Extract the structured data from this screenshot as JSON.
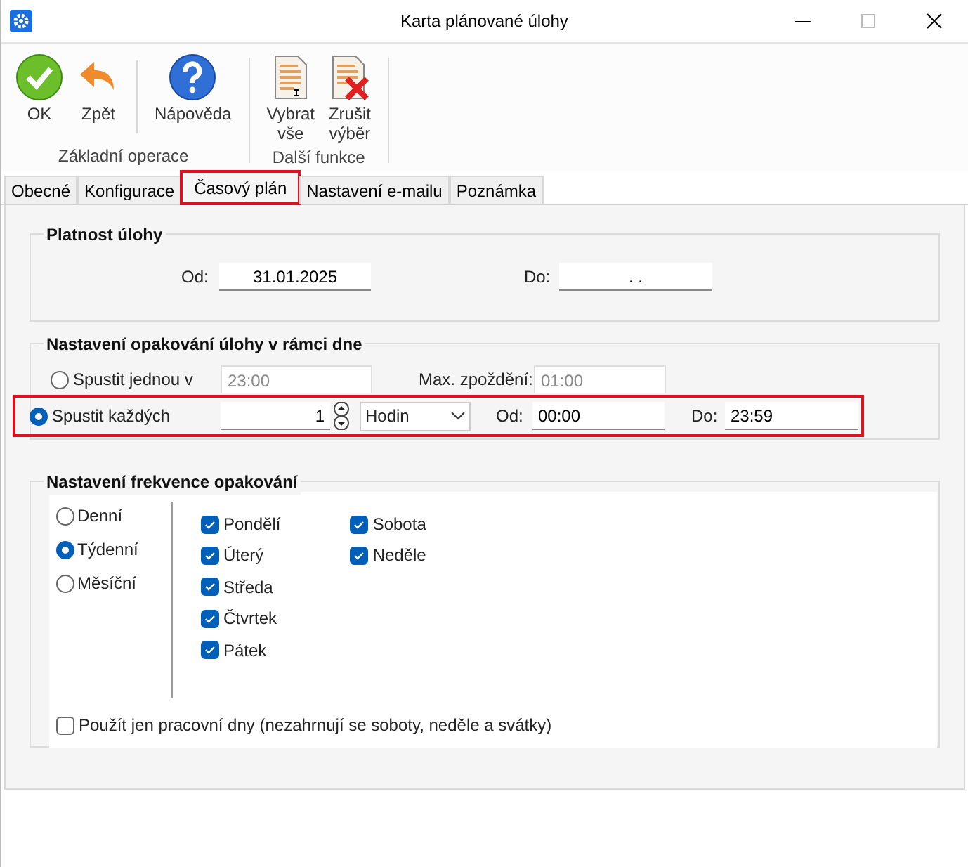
{
  "window": {
    "title": "Karta plánované úlohy"
  },
  "toolbar": {
    "groups": [
      {
        "label": "Základní operace",
        "buttons": [
          {
            "kind": "ok",
            "label": "OK"
          },
          {
            "kind": "back",
            "label": "Zpět"
          },
          {
            "kind": "separator"
          },
          {
            "kind": "help",
            "label": "Nápověda"
          }
        ]
      },
      {
        "label": "Další funkce",
        "buttons": [
          {
            "kind": "select",
            "label": "Vybrat vše"
          },
          {
            "kind": "deselect",
            "label": "Zrušit výběr"
          }
        ]
      }
    ]
  },
  "tabs": [
    {
      "label": "Obecné",
      "selected": false,
      "highlighted": false
    },
    {
      "label": "Konfigurace",
      "selected": false,
      "highlighted": false
    },
    {
      "label": "Časový plán",
      "selected": true,
      "highlighted": true
    },
    {
      "label": "Nastavení e-mailu",
      "selected": false,
      "highlighted": false
    },
    {
      "label": "Poznámka",
      "selected": false,
      "highlighted": false
    }
  ],
  "validity": {
    "title": "Platnost úlohy",
    "from_label": "Od:",
    "from_value": "31.01.2025",
    "to_label": "Do:",
    "to_value": ". ."
  },
  "repeat": {
    "title": "Nastavení opakování úlohy v rámci dne",
    "once": {
      "label": "Spustit jednou v",
      "selected": false,
      "time": "23:00",
      "delay_label": "Max. zpoždění:",
      "delay": "01:00"
    },
    "every": {
      "label": "Spustit každých",
      "selected": true,
      "highlighted": true,
      "count": "1",
      "unit": "Hodin",
      "from_label": "Od:",
      "from": "00:00",
      "to_label": "Do:",
      "to": "23:59"
    }
  },
  "frequency": {
    "title": "Nastavení frekvence opakování",
    "modes": [
      {
        "label": "Denní",
        "selected": false
      },
      {
        "label": "Týdenní",
        "selected": true
      },
      {
        "label": "Měsíční",
        "selected": false
      }
    ],
    "days": [
      {
        "label": "Pondělí",
        "checked": true
      },
      {
        "label": "Úterý",
        "checked": true
      },
      {
        "label": "Středa",
        "checked": true
      },
      {
        "label": "Čtvrtek",
        "checked": true
      },
      {
        "label": "Pátek",
        "checked": true
      },
      {
        "label": "Sobota",
        "checked": true
      },
      {
        "label": "Neděle",
        "checked": true
      }
    ],
    "workdays": {
      "label": "Použít jen pracovní dny (nezahrnují se soboty, neděle a svátky)",
      "checked": false
    }
  }
}
